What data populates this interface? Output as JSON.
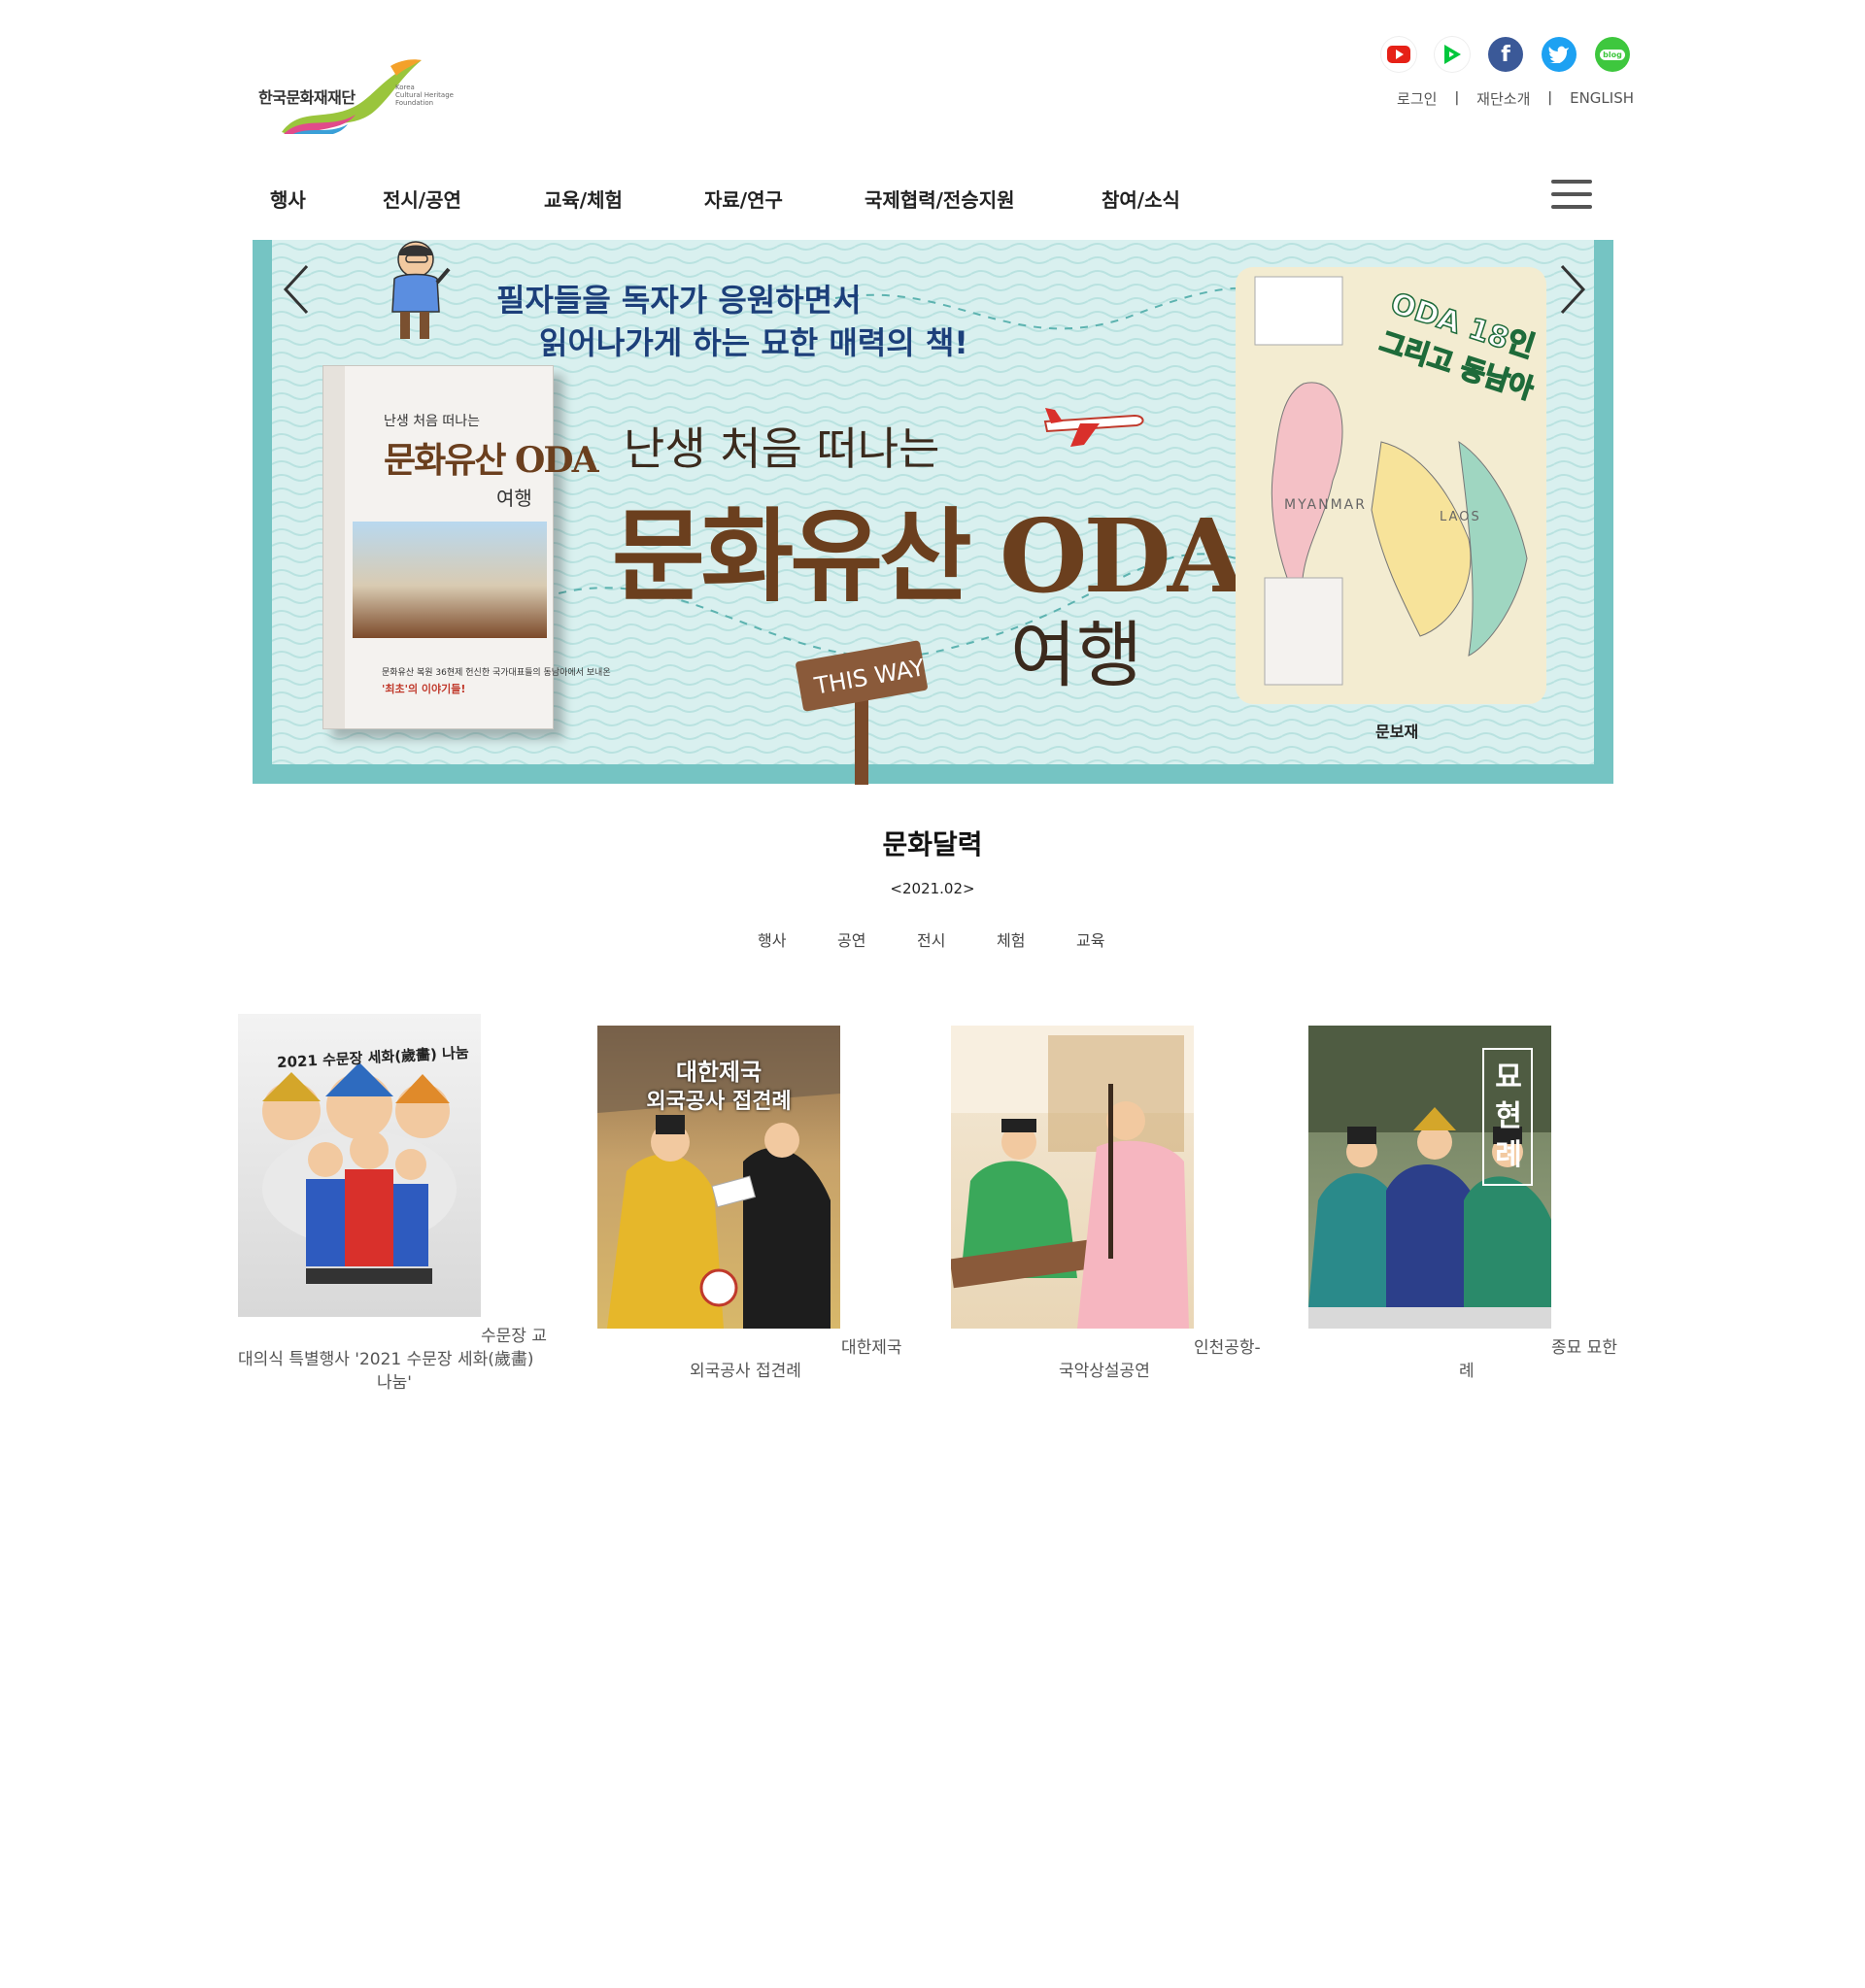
{
  "header": {
    "logo_text": "한국문화재재단",
    "logo_sub": [
      "Korea",
      "Cultural Heritage",
      "Foundation"
    ],
    "social_icons": [
      {
        "name": "youtube-icon",
        "color": "#e62117"
      },
      {
        "name": "naver-tv-icon",
        "color": "#00c73c"
      },
      {
        "name": "facebook-icon",
        "color": "#3b5998"
      },
      {
        "name": "twitter-icon",
        "color": "#1da1f2"
      },
      {
        "name": "blog-icon",
        "color": "#3ec73e"
      }
    ],
    "blog_label": "blog",
    "util_links": [
      "로그인",
      "재단소개",
      "ENGLISH"
    ],
    "util_separator": "|"
  },
  "nav": {
    "items": [
      "행사",
      "전시/공연",
      "교육/체험",
      "자료/연구",
      "국제협력/전승지원",
      "참여/소식"
    ]
  },
  "banner": {
    "tagline_line1": "필자들을 독자가 응원하면서",
    "tagline_line2": "읽어나가게 하는 묘한 매력의 책!",
    "subtitle": "난생 처음 떠나는",
    "title": "문화유산 ODA",
    "title_trip": "여행",
    "sign": "THIS WAY",
    "book": {
      "subtitle": "난생 처음 떠나는",
      "title": "문화유산 ODA",
      "trip": "여행",
      "note": "문화유산 복원 36현제 헌신한 국가대표들의 동남아에서 보내온",
      "first": "'최초'의 이야기들!"
    },
    "map": {
      "title1": "ODA 18인",
      "title2": "그리고 동남아",
      "country1": "MYANMAR",
      "country2": "LAOS",
      "publisher": "문보재"
    },
    "colors": {
      "frame": "#75c4c3",
      "background": "#d9f0ef",
      "title": "#6b3f1e",
      "tagline": "#1c3f7a"
    }
  },
  "calendar": {
    "title": "문화달력",
    "month_prev": "<",
    "month": "2021.02",
    "month_next": ">",
    "tabs": [
      "행사",
      "공연",
      "전시",
      "체험",
      "교육"
    ]
  },
  "cards": [
    {
      "image_text": "2021 수문장 세화(歲畵) 나눔",
      "caption_line1": "수문장 교",
      "caption_line2": "대의식 특별행사 '2021 수문장 세화(歲畵)",
      "caption_line3": "나눔'"
    },
    {
      "image_text_line1": "대한제국",
      "image_text_line2": "외국공사 접견례",
      "caption_line1": "대한제국",
      "caption_line2": "외국공사 접견례"
    },
    {
      "caption_line1": "인천공항-",
      "caption_line2": "국악상설공연"
    },
    {
      "image_text": "묘현례",
      "caption_line1": "종묘 묘한",
      "caption_line2": "례"
    }
  ]
}
